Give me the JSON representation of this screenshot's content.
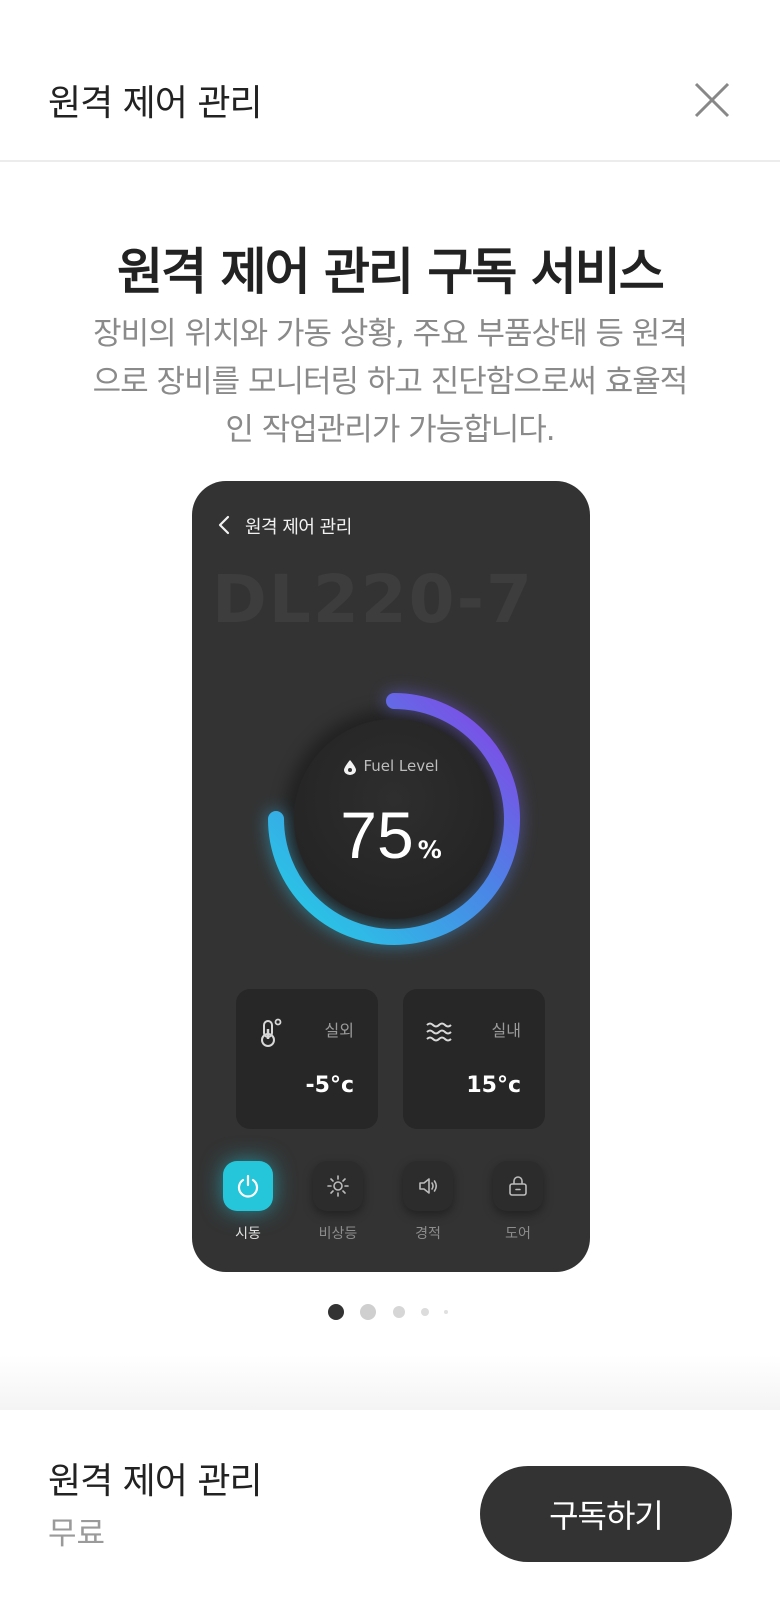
{
  "header": {
    "title": "원격 제어 관리",
    "close_icon": "close-icon"
  },
  "hero": {
    "title": "원격 제어 관리 구독 서비스",
    "description": "장비의 위치와 가동 상황, 주요 부품상태 등 원격으로 장비를 모니터링 하고 진단함으로써 효율적인 작업관리가 가능합니다."
  },
  "preview": {
    "title": "원격 제어 관리",
    "model": "DL220-7",
    "gauge": {
      "label": "Fuel Level",
      "value": "75",
      "unit": "%",
      "fraction": 0.75,
      "color_start": "#22d3e6",
      "color_end": "#8a3fe6"
    },
    "tiles": [
      {
        "label": "실외",
        "value": "-5°c",
        "icon": "thermometer-icon"
      },
      {
        "label": "실내",
        "value": "15°c",
        "icon": "waves-icon"
      }
    ],
    "controls": [
      {
        "label": "시동",
        "icon": "power-icon",
        "active": true
      },
      {
        "label": "비상등",
        "icon": "sun-icon",
        "active": false
      },
      {
        "label": "경적",
        "icon": "speaker-icon",
        "active": false
      },
      {
        "label": "도어",
        "icon": "lock-icon",
        "active": false
      }
    ],
    "accent": "#25c6da"
  },
  "carousel": {
    "total": 5,
    "current": 1
  },
  "bottom": {
    "name": "원격 제어 관리",
    "price": "무료",
    "button_label": "구독하기"
  }
}
